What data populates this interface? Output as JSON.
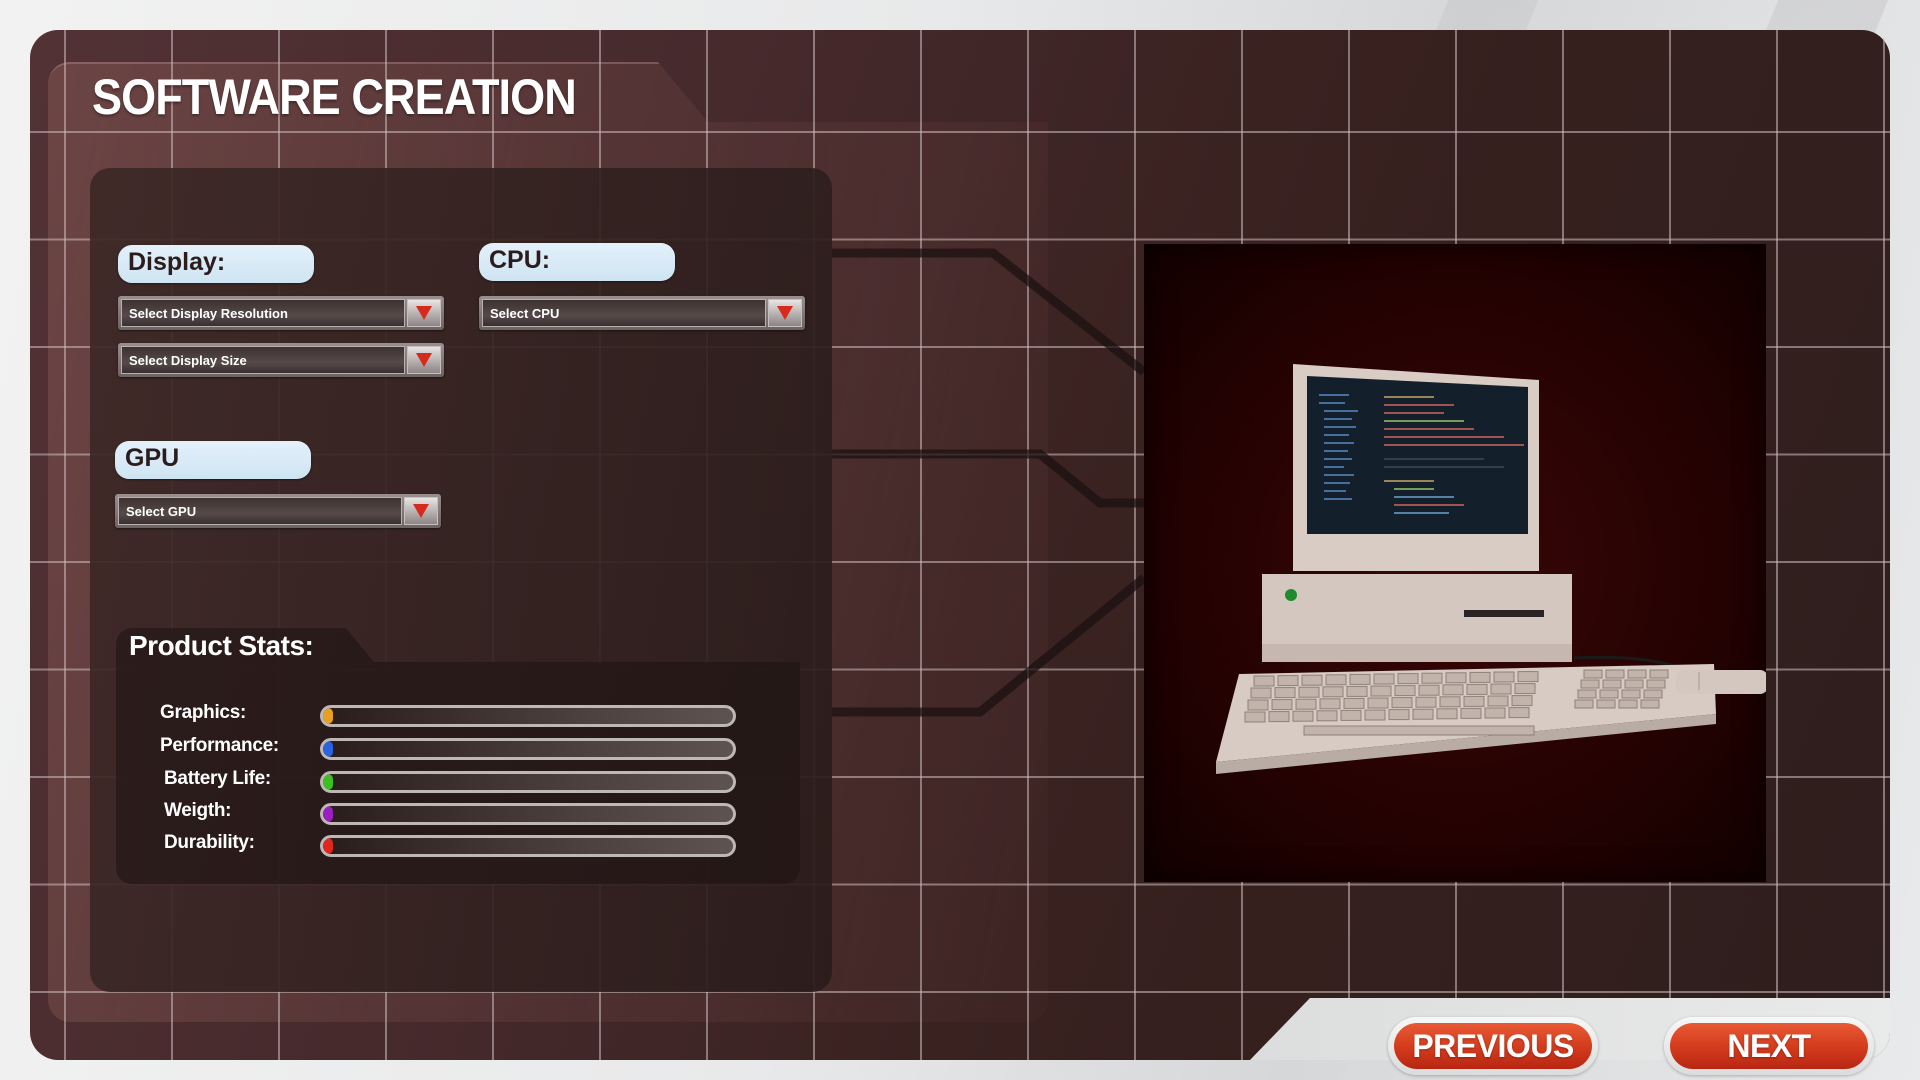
{
  "header": {
    "title": "SOFTWARE CREATION"
  },
  "config": {
    "display": {
      "label": "Display:",
      "resolution_dropdown": {
        "value": "Select Display Resolution"
      },
      "size_dropdown": {
        "value": "Select Display Size"
      }
    },
    "cpu": {
      "label": "CPU:",
      "dropdown": {
        "value": "Select CPU"
      }
    },
    "gpu": {
      "label": "GPU",
      "dropdown": {
        "value": "Select GPU"
      }
    }
  },
  "stats": {
    "title": "Product Stats:",
    "items": [
      {
        "label": "Graphics:",
        "value": 0,
        "color": "#e8a020"
      },
      {
        "label": "Performance:",
        "value": 0,
        "color": "#2a63e0"
      },
      {
        "label": "Battery Life:",
        "value": 0,
        "color": "#3cc021"
      },
      {
        "label": "Weigth:",
        "value": 0,
        "color": "#9a1fc0"
      },
      {
        "label": "Durability:",
        "value": 0,
        "color": "#e0261f"
      }
    ]
  },
  "preview": {
    "subject": "retro desktop computer with monitor, keyboard and mouse"
  },
  "nav": {
    "previous_label": "PREVIOUS",
    "next_label": "NEXT"
  },
  "theme": {
    "accent": "#d23a1c",
    "label_bg": "#d8eaf6",
    "frame": "#45292b"
  }
}
